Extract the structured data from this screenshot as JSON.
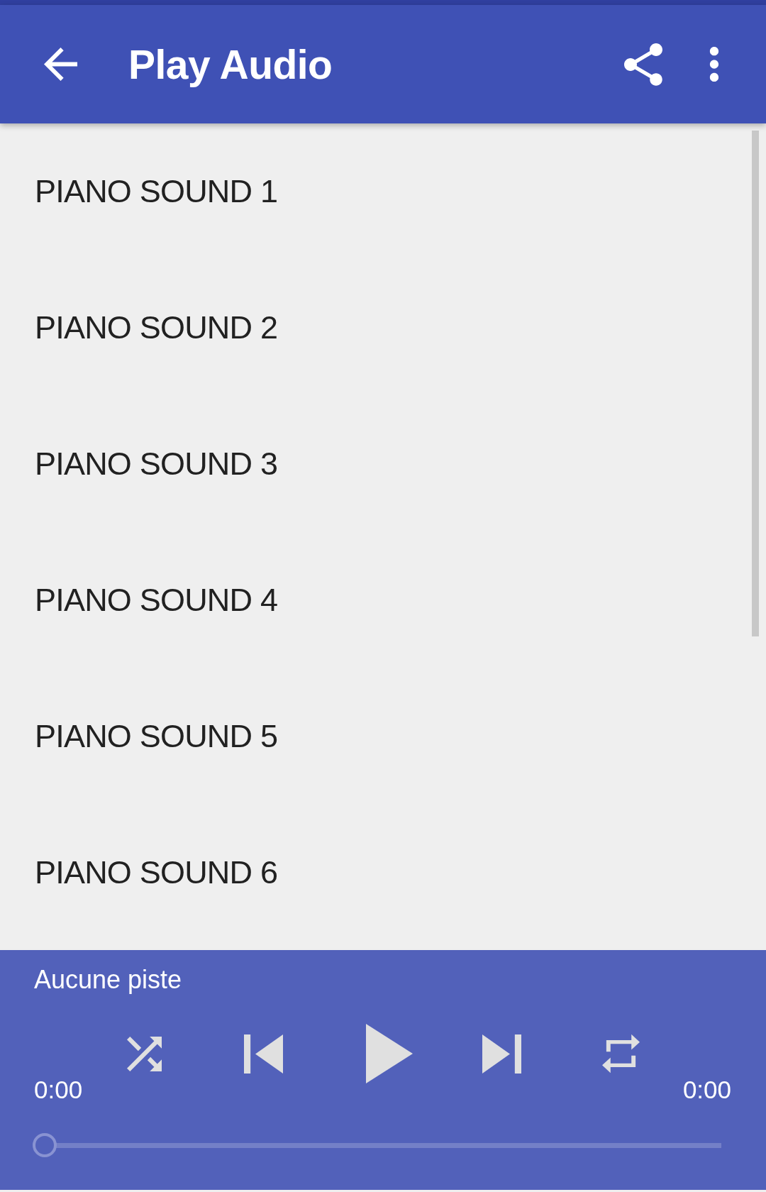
{
  "app_bar": {
    "title": "Play Audio"
  },
  "tracks": [
    {
      "title": "PIANO SOUND 1"
    },
    {
      "title": "PIANO SOUND 2"
    },
    {
      "title": "PIANO SOUND 3"
    },
    {
      "title": "PIANO SOUND 4"
    },
    {
      "title": "PIANO SOUND 5"
    },
    {
      "title": "PIANO SOUND 6"
    }
  ],
  "player": {
    "track_title": "Aucune piste",
    "elapsed": "0:00",
    "duration": "0:00",
    "progress": {
      "level": 0
    }
  }
}
